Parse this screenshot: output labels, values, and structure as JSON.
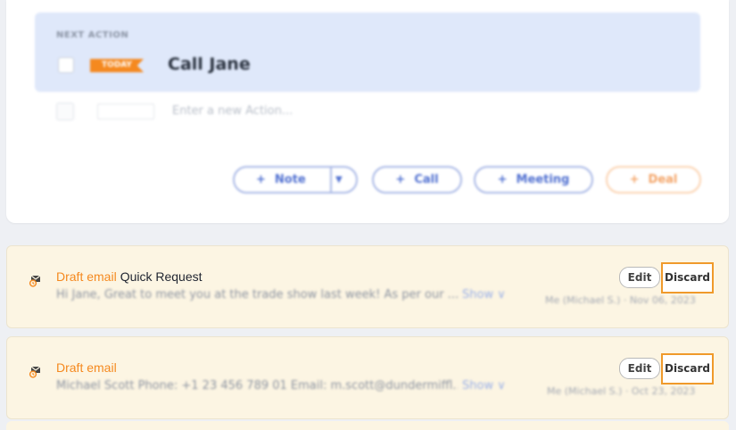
{
  "next_action": {
    "section_label": "NEXT ACTION",
    "tag_label": "TODAY",
    "title": "Call Jane"
  },
  "new_action": {
    "placeholder": "Enter a new Action..."
  },
  "action_buttons": {
    "note": "Note",
    "call": "Call",
    "meeting": "Meeting",
    "deal": "Deal",
    "plus": "+"
  },
  "emails": [
    {
      "draft_label": "Draft email",
      "subject": "Quick Request",
      "preview": "Hi Jane, Great to meet you at the trade show last week! As per our ...",
      "show_label": "Show ∨",
      "meta": "Me (Michael S.) · Nov 06, 2023",
      "edit_label": "Edit",
      "discard_label": "Discard"
    },
    {
      "draft_label": "Draft email",
      "subject": "",
      "preview": "Michael Scott Phone: +1 23 456 789 01 Email: m.scott@dundermiffl...",
      "show_label": "Show ∨",
      "meta": "Me (Michael S.) · Oct 23, 2023",
      "edit_label": "Edit",
      "discard_label": "Discard"
    }
  ],
  "colors": {
    "accent_orange": "#f5891f",
    "action_blue": "#4f6fd0",
    "draft_bg": "#fcf5e3",
    "highlight_bg": "#dfe8fa"
  }
}
